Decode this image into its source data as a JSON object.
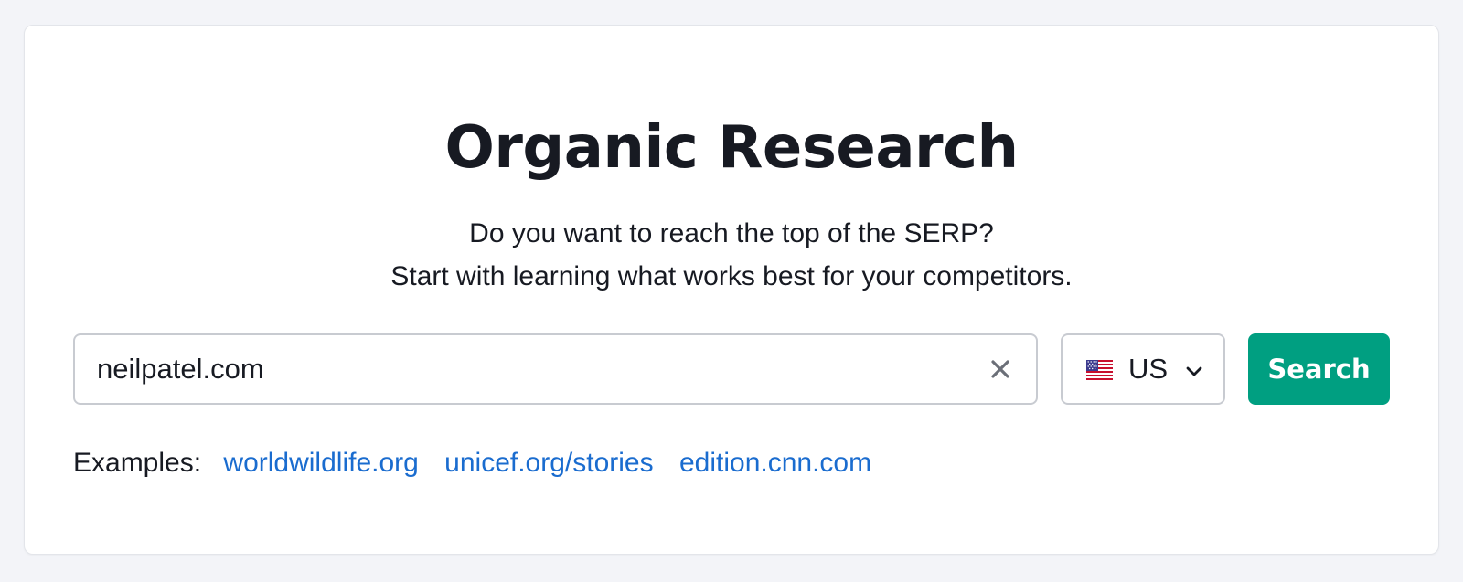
{
  "header": {
    "title": "Organic Research",
    "subtitle_line1": "Do you want to reach the top of the SERP?",
    "subtitle_line2": "Start with learning what works best for your competitors."
  },
  "search": {
    "value": "neilpatel.com",
    "clear_icon": "close-icon",
    "database": {
      "flag_icon": "us-flag-icon",
      "label": "US",
      "dropdown_icon": "chevron-down-icon"
    },
    "button_label": "Search"
  },
  "examples": {
    "label": "Examples:",
    "links": [
      "worldwildlife.org",
      "unicef.org/stories",
      "edition.cnn.com"
    ]
  },
  "colors": {
    "background": "#f3f4f8",
    "card": "#ffffff",
    "text": "#171a22",
    "accent": "#009f81",
    "link": "#1a6ccf"
  }
}
